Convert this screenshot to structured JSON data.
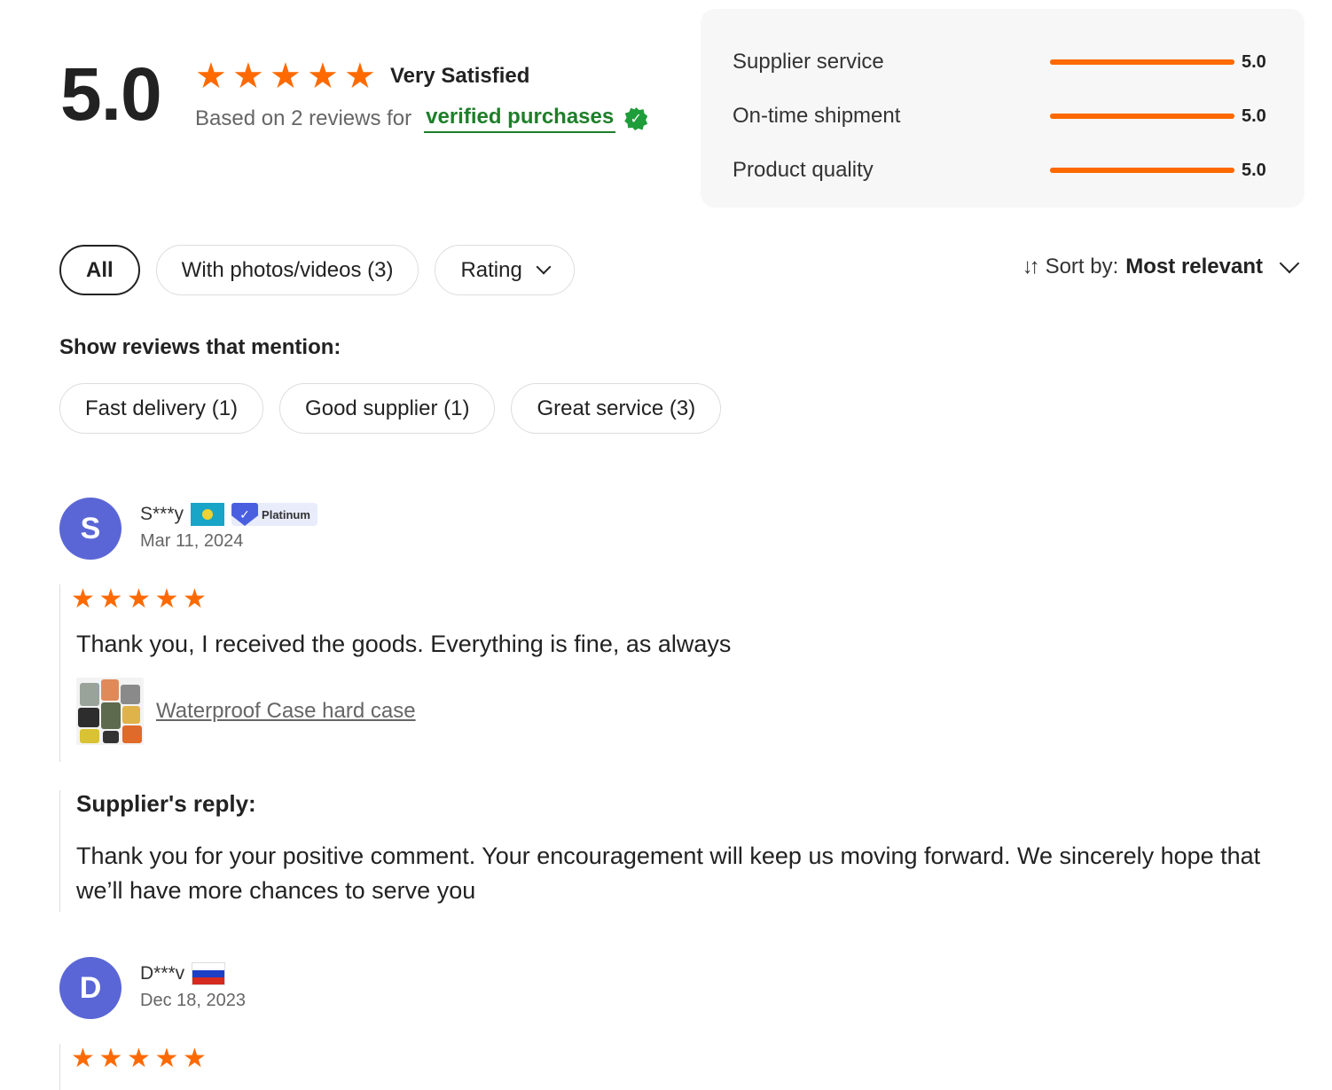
{
  "summary": {
    "score": "5.0",
    "stars": 5,
    "satisfaction": "Very Satisfied",
    "based_on": "Based on 2 reviews for",
    "verified": "verified purchases",
    "verified_icon": "verified-check-icon"
  },
  "ratings": [
    {
      "label": "Supplier service",
      "value": "5.0",
      "fraction": 1.0
    },
    {
      "label": "On-time shipment",
      "value": "5.0",
      "fraction": 1.0
    },
    {
      "label": "Product quality",
      "value": "5.0",
      "fraction": 1.0
    }
  ],
  "filters": {
    "all": "All",
    "photos": "With photos/videos (3)",
    "rating": "Rating"
  },
  "sort": {
    "label": "Sort by:",
    "value": "Most relevant"
  },
  "mentions": {
    "title": "Show reviews that mention:",
    "tags": [
      "Fast delivery (1)",
      "Good supplier (1)",
      "Great service (3)"
    ]
  },
  "reviews": [
    {
      "initial": "S",
      "name": "S***y",
      "flag": "flag-kazakhstan",
      "badge": "Platinum",
      "date": "Mar 11, 2024",
      "stars": 5,
      "text": "Thank you, I received the goods. Everything is fine, as always",
      "product": "Waterproof Case hard case",
      "reply_title": "Supplier's reply:",
      "reply_text": "Thank you for your positive comment. Your encouragement will keep us moving forward. We sincerely hope that we’ll have more chances to serve you"
    },
    {
      "initial": "D",
      "name": "D***v",
      "flag": "flag-russia",
      "date": "Dec 18, 2023",
      "stars": 5
    }
  ],
  "colors": {
    "accent": "#ff6a00",
    "verified_green": "#1e7f2a",
    "avatar": "#5b66d6"
  }
}
